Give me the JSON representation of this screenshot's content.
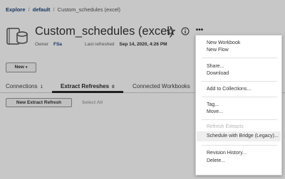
{
  "breadcrumb": {
    "root": "Explore",
    "sep1": "/",
    "project": "default",
    "sep2": "/",
    "current": "Custom_schedules (excel)"
  },
  "header": {
    "title": "Custom_schedules (excel)",
    "owner_label": "Owner",
    "owner_value": "FSa",
    "refreshed_label": "Last refreshed",
    "refreshed_value": "Sep 14, 2020, 4:26 PM",
    "icons": [
      "datasource-icon",
      "star-icon",
      "info-icon",
      "more-icon"
    ]
  },
  "new_button": {
    "label": "New",
    "caret": "▾"
  },
  "tabs": [
    {
      "label": "Connections",
      "count": "1"
    },
    {
      "label": "Extract Refreshes",
      "count": "0"
    },
    {
      "label": "Connected Workbooks",
      "count": ""
    }
  ],
  "actions": {
    "new_refresh": "New Extract Refresh",
    "select_all": "Select All"
  },
  "menu": {
    "items": [
      {
        "label": "New Workbook",
        "disabled": false
      },
      {
        "label": "New Flow",
        "disabled": false
      },
      {
        "label": "Share...",
        "disabled": false
      },
      {
        "label": "Download",
        "disabled": false
      },
      {
        "label": "Add to Collections...",
        "disabled": false
      },
      {
        "label": "Tag...",
        "disabled": false
      },
      {
        "label": "Move...",
        "disabled": false
      },
      {
        "label": "Refresh Extracts",
        "disabled": true
      },
      {
        "label": "Schedule with Bridge (Legacy)...",
        "disabled": false
      },
      {
        "label": "Revision History...",
        "disabled": false
      },
      {
        "label": "Delete...",
        "disabled": false
      }
    ]
  },
  "colors": {
    "link": "#1f457e",
    "overlay": "rgba(0,0,0,0.22)",
    "highlight": "#eeeeee"
  }
}
